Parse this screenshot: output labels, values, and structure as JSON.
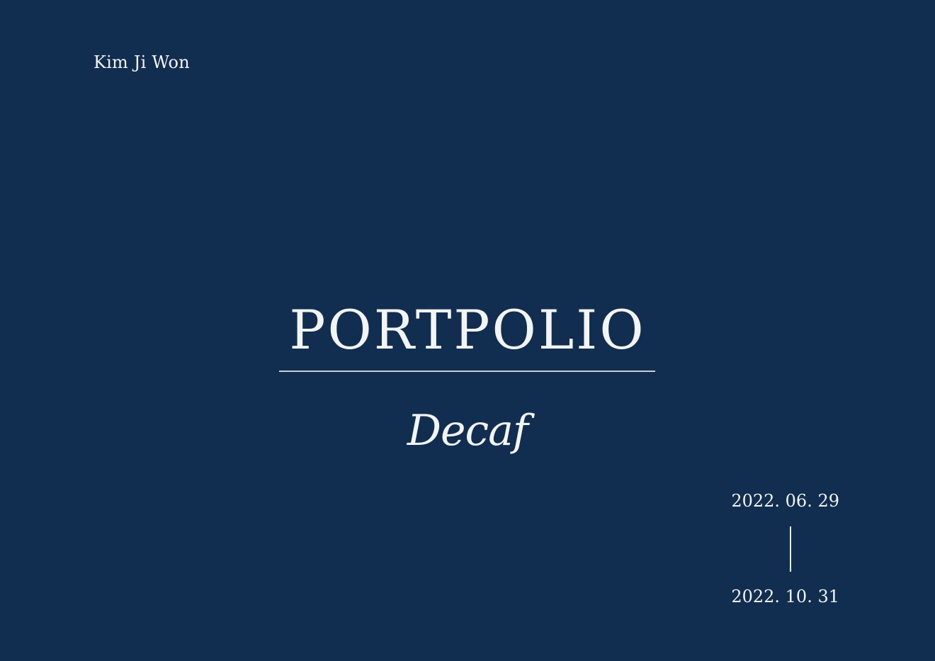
{
  "author": "Kim Ji Won",
  "title": "PORTPOLIO",
  "subtitle": "Decaf",
  "dates": {
    "start": "2022. 06. 29",
    "end": "2022. 10. 31"
  },
  "colors": {
    "background": "#112d4f",
    "text": "#f3f4f6",
    "rule": "#c9ced6"
  }
}
